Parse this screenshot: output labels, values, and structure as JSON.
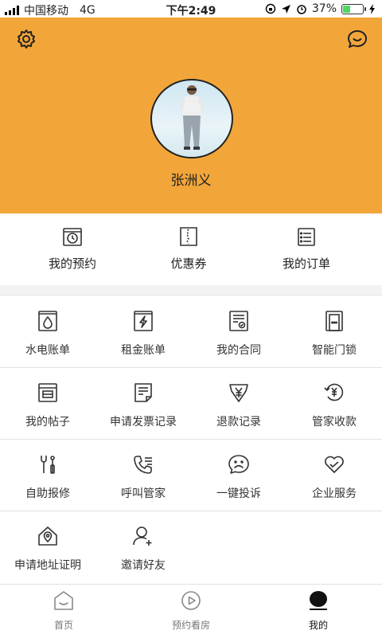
{
  "status_bar": {
    "carrier": "中国移动",
    "network": "4G",
    "time": "下午2:49",
    "battery": "37%",
    "battery_level": 0.37
  },
  "header": {
    "bg_color": "#f2a63a",
    "settings_icon": "gear-icon",
    "message_icon": "chat-bubble-icon",
    "user_name": "张洲义"
  },
  "quick_actions": [
    {
      "label": "我的预约",
      "icon": "clock-calendar-icon"
    },
    {
      "label": "优惠券",
      "icon": "coupon-icon"
    },
    {
      "label": "我的订单",
      "icon": "order-list-icon"
    }
  ],
  "services": [
    {
      "label": "水电账单",
      "icon": "water-drop-icon"
    },
    {
      "label": "租金账单",
      "icon": "lightning-icon"
    },
    {
      "label": "我的合同",
      "icon": "contract-icon"
    },
    {
      "label": "智能门锁",
      "icon": "door-lock-icon"
    },
    {
      "label": "我的帖子",
      "icon": "post-icon"
    },
    {
      "label": "申请发票记录",
      "icon": "invoice-icon"
    },
    {
      "label": "退款记录",
      "icon": "refund-icon"
    },
    {
      "label": "管家收款",
      "icon": "yuan-collect-icon"
    },
    {
      "label": "自助报修",
      "icon": "repair-tools-icon"
    },
    {
      "label": "呼叫管家",
      "icon": "phone-call-icon"
    },
    {
      "label": "一键投诉",
      "icon": "sad-face-icon"
    },
    {
      "label": "企业服务",
      "icon": "heart-icon"
    },
    {
      "label": "申请地址证明",
      "icon": "home-pin-icon"
    },
    {
      "label": "邀请好友",
      "icon": "add-user-icon"
    }
  ],
  "tab_bar": [
    {
      "label": "首页",
      "icon": "home-icon",
      "active": false
    },
    {
      "label": "预约看房",
      "icon": "play-circle-icon",
      "active": false
    },
    {
      "label": "我的",
      "icon": "user-icon",
      "active": true
    }
  ]
}
